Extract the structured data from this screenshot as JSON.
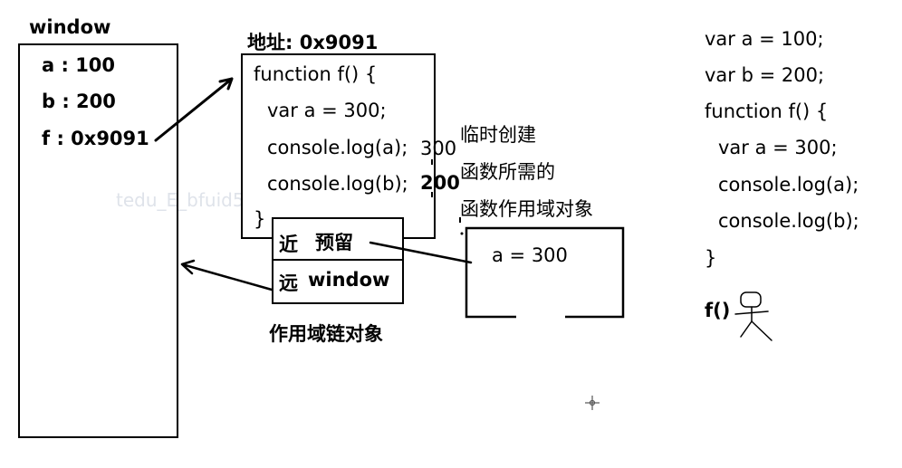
{
  "window_panel": {
    "title": "window",
    "vars": [
      "a : 100",
      "b : 200",
      "f : 0x9091"
    ]
  },
  "function_panel": {
    "address": "地址: 0x9091",
    "lines": [
      "function f() {",
      "var a = 300;",
      "console.log(a);",
      "console.log(b);",
      "}"
    ],
    "out_a": "300",
    "out_b": "200"
  },
  "scope_chain": {
    "near_label": "近",
    "near_value": "预留",
    "far_label": "远",
    "far_value": "window",
    "caption": "作用域链对象"
  },
  "temp_scope": {
    "note": [
      "临时创建",
      "函数所需的",
      "函数作用域对象"
    ],
    "content": "a = 300"
  },
  "code_listing": {
    "lines": [
      "var a = 100;",
      "var b = 200;",
      "function f() {",
      "var a = 300;",
      "console.log(a);",
      "console.log(b);",
      "}"
    ],
    "call": "f()"
  },
  "watermark": "tedu_E_bfuid5",
  "colors": {
    "ink": "#000000",
    "background": "#ffffff",
    "watermark": "#dfe3ea"
  }
}
